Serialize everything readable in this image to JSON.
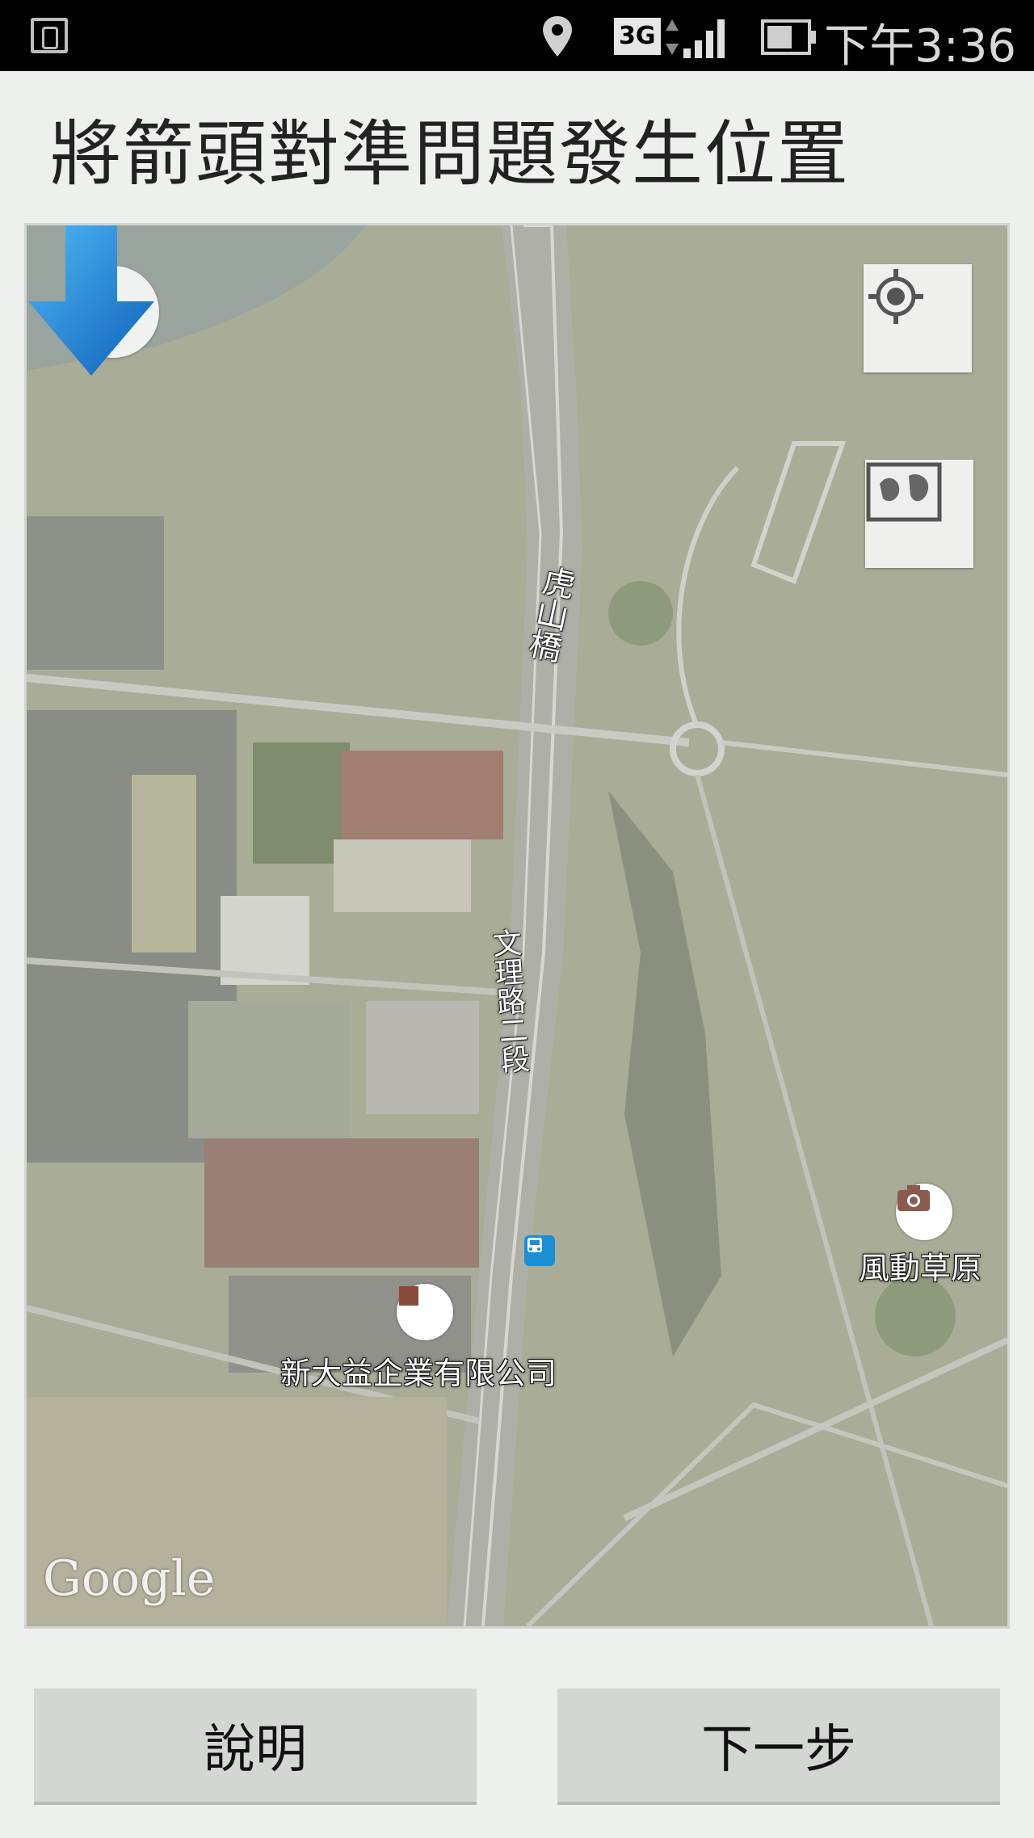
{
  "status_bar": {
    "time": "下午3:36",
    "network": "3G",
    "icons": [
      "notification-icon",
      "location-icon",
      "signal-icon",
      "battery-icon"
    ]
  },
  "header": {
    "title": "將箭頭對準問題發生位置"
  },
  "map": {
    "roads": {
      "bridge": "虎山橋",
      "street": "文理路二段"
    },
    "pois": [
      {
        "name": "風動草原",
        "icon": "camera-icon"
      },
      {
        "name": "新大益企業有限公司",
        "icon": "business-icon"
      }
    ],
    "attribution": "Google",
    "controls": [
      "compass-icon",
      "my-location-icon",
      "map-layers-icon"
    ],
    "colors": {
      "pointer": "#1a7fd6"
    }
  },
  "buttons": {
    "help": "說明",
    "next": "下一步"
  }
}
